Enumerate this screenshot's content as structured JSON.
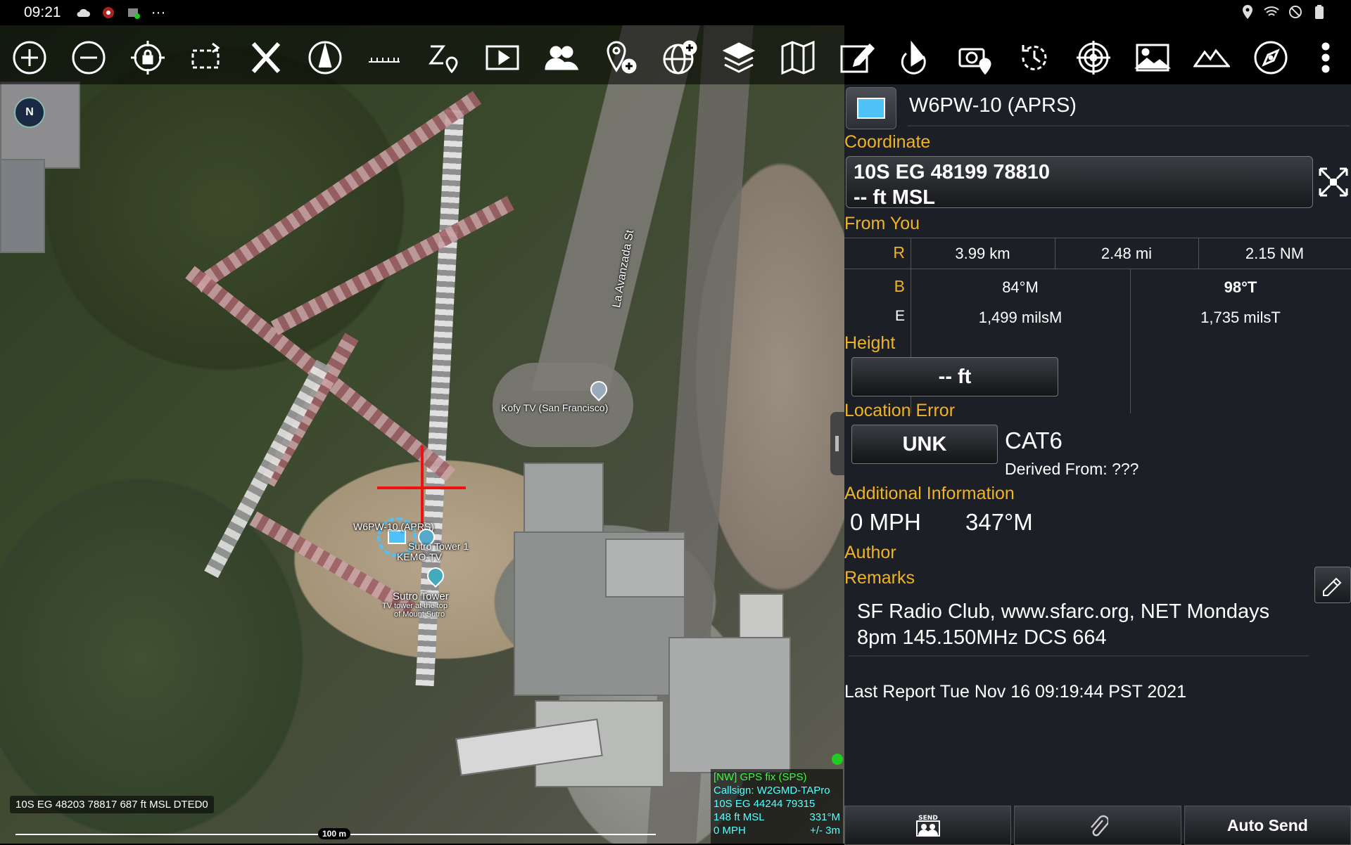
{
  "status_bar": {
    "time": "09:21",
    "left_icons": [
      "cloud-icon",
      "app-icon-red",
      "app-icon-green",
      "more-dots-icon"
    ],
    "more": "···",
    "right_icons": [
      "location-icon",
      "wifi-icon",
      "dnd-icon",
      "battery-icon"
    ]
  },
  "toolbar": {
    "buttons": [
      "zoom-in",
      "zoom-out",
      "lock-location",
      "rotate",
      "close-x",
      "trail",
      "ruler",
      "z-pin",
      "play",
      "contacts",
      "add-pin",
      "globe-add",
      "layers",
      "map",
      "edit",
      "route",
      "camera-pin",
      "rotate-history",
      "target",
      "image",
      "terrain",
      "compass",
      "overflow-menu"
    ]
  },
  "map": {
    "compass_letter": "N",
    "street": "La Avanzada St",
    "poi_kofy": "Kofy TV (San Francisco)",
    "marker_label": "W6PW-10 (APRS)",
    "poi_sutro1": "Sutro Tower 1",
    "poi_kemo": "KEMO-TV",
    "poi_sutro": "Sutro Tower",
    "poi_sutro_desc1": "TV tower at the top",
    "poi_sutro_desc2": "of Mount Sutro",
    "cursor_coord": "10S EG 48203 78817 687 ft MSL DTED0",
    "scale": "100 m",
    "gps": {
      "fix": "[NW] GPS fix (SPS)",
      "callsign": "Callsign: W2GMD-TAPro",
      "coord": "10S  EG  44244  79315",
      "alt": "148 ft MSL",
      "bearing": "331°M",
      "speed": "0 MPH",
      "error": "+/- 3m"
    }
  },
  "panel": {
    "callsign": "W6PW-10 (APRS)",
    "coordinate_label": "Coordinate",
    "coordinate_line1": "10S EG 48199 78810",
    "coordinate_line2": "-- ft MSL",
    "from_you_label": "From You",
    "r_label": "R",
    "range_km": "3.99 km",
    "range_mi": "2.48 mi",
    "range_nm": "2.15 NM",
    "b_label": "B",
    "bearing_m": "84°M",
    "bearing_t": "98°T",
    "e_label": "E",
    "mils_m": "1,499 milsM",
    "mils_t": "1,735 milsT",
    "height_label": "Height",
    "height_value": "-- ft",
    "loc_error_label": "Location Error",
    "loc_error_value": "UNK",
    "category": "CAT6",
    "derived_from": "Derived From: ???",
    "additional_label": "Additional Information",
    "speed": "0 MPH",
    "course": "347°M",
    "author_label": "Author",
    "remarks_label": "Remarks",
    "remarks_line1": "SF Radio Club, www.sfarc.org, NET Mondays",
    "remarks_line2": "8pm 145.150MHz DCS 664",
    "last_report": "Last Report Tue Nov 16 09:19:44 PST 2021",
    "send_label": "SEND",
    "auto_send": "Auto Send"
  },
  "colors": {
    "accent": "#f0b323",
    "panel_bg": "#1c1f25",
    "crosshair": "#ee1111",
    "gps_green": "#33ff33",
    "gps_cyan": "#55ffff"
  }
}
